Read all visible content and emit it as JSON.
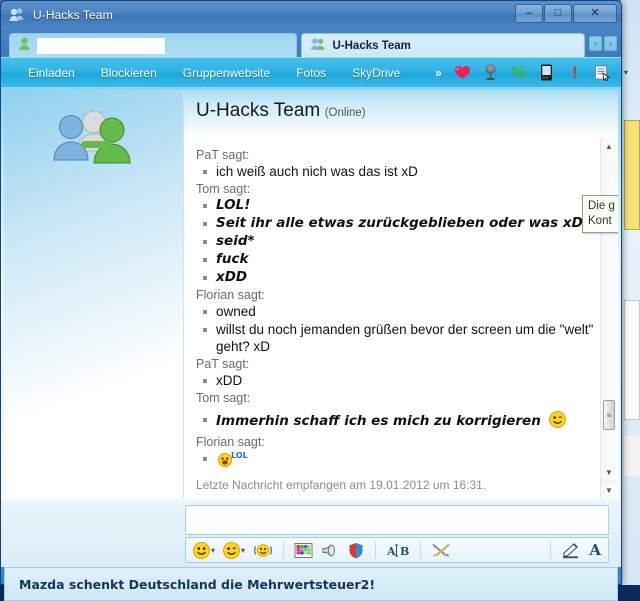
{
  "window": {
    "title": "U-Hacks Team",
    "app_icon": "group-contacts-icon",
    "controls": {
      "minimize": "–",
      "maximize": "□",
      "close": "✕"
    }
  },
  "tabs": {
    "inactive": {
      "label": "",
      "icon": "contact-icon"
    },
    "active": {
      "label": "U-Hacks Team",
      "icon": "group-contacts-icon"
    },
    "nav_prev": "‹",
    "nav_next": "›"
  },
  "menu": {
    "items": [
      {
        "label": "Einladen"
      },
      {
        "label": "Blockieren"
      },
      {
        "label": "Gruppenwebsite"
      },
      {
        "label": "Fotos"
      },
      {
        "label": "SkyDrive"
      }
    ],
    "overflow": "»",
    "icons": [
      {
        "name": "heart-icon",
        "glyph": "❤"
      },
      {
        "name": "microphone-icon",
        "glyph": "🎤"
      },
      {
        "name": "percent-discount-icon",
        "glyph": "%"
      },
      {
        "name": "mobile-phone-icon",
        "glyph": "▯"
      },
      {
        "name": "alert-exclamation-icon",
        "glyph": "!"
      },
      {
        "name": "notes-icon",
        "glyph": "▤"
      }
    ],
    "caret": "▾"
  },
  "conversation": {
    "title": "U-Hacks Team",
    "status": "(Online)",
    "avatar": "group-avatar",
    "messages": [
      {
        "sender": "PaT sagt:",
        "lines": [
          {
            "text": "ich weiß auch nich was das ist xD",
            "style": "normal"
          }
        ]
      },
      {
        "sender": "Tom sagt:",
        "lines": [
          {
            "text": "LOL!",
            "style": "comic"
          },
          {
            "text": "Seit ihr alle etwas zurückgeblieben oder was xD",
            "style": "comic"
          },
          {
            "text": "seid*",
            "style": "comic"
          },
          {
            "text": "fuck",
            "style": "comic"
          },
          {
            "text": "xDD",
            "style": "comic"
          }
        ]
      },
      {
        "sender": "Florian sagt:",
        "lines": [
          {
            "text": "owned",
            "style": "normal"
          },
          {
            "text": "willst du noch jemanden grüßen bevor der screen um die \"welt\" geht? xD",
            "style": "normal"
          }
        ]
      },
      {
        "sender": "PaT sagt:",
        "lines": [
          {
            "text": "xDD",
            "style": "normal"
          }
        ]
      },
      {
        "sender": "Tom sagt:",
        "lines": [
          {
            "text": "Immerhin schaff ich es mich zu korrigieren",
            "style": "comic",
            "emoticon": "wink-smiley"
          }
        ]
      },
      {
        "sender": "Florian sagt:",
        "lines": [
          {
            "text": "",
            "style": "normal",
            "emoticon": "lol-smiley"
          }
        ]
      }
    ],
    "last_message_note": "Letzte Nachricht empfangen am 19.01.2012 um 16:31."
  },
  "tooltip": {
    "line1": "Die g",
    "line2": "Kont"
  },
  "scrollbar": {
    "up": "▲",
    "down": "▼",
    "page_down": "▼"
  },
  "compose": {
    "value": "",
    "placeholder": ""
  },
  "format_bar": {
    "buttons": [
      {
        "name": "emoticon-picker",
        "glyph": "☺",
        "caret": "▾"
      },
      {
        "name": "winks-picker",
        "glyph": "😉",
        "caret": "▾"
      },
      {
        "name": "nudge-button",
        "glyph": "(☺)"
      },
      {
        "name": "backgrounds-button",
        "glyph": "▦"
      },
      {
        "name": "sound-button",
        "glyph": "◉"
      },
      {
        "name": "games-button",
        "glyph": "◈"
      },
      {
        "name": "translate-button",
        "glyph": "A|B"
      },
      {
        "name": "activities-button",
        "glyph": "✂"
      },
      {
        "name": "handwriting-button",
        "glyph": "✎"
      },
      {
        "name": "font-button",
        "glyph": "A"
      }
    ]
  },
  "ad": {
    "text": "Mazda schenkt Deutschland die Mehrwertsteuer2!"
  },
  "colors": {
    "title_bar": "#4b82c0",
    "menu_bar": "#2fb3e4",
    "accent": "#1fa6dd",
    "ad_text": "#16335a"
  }
}
